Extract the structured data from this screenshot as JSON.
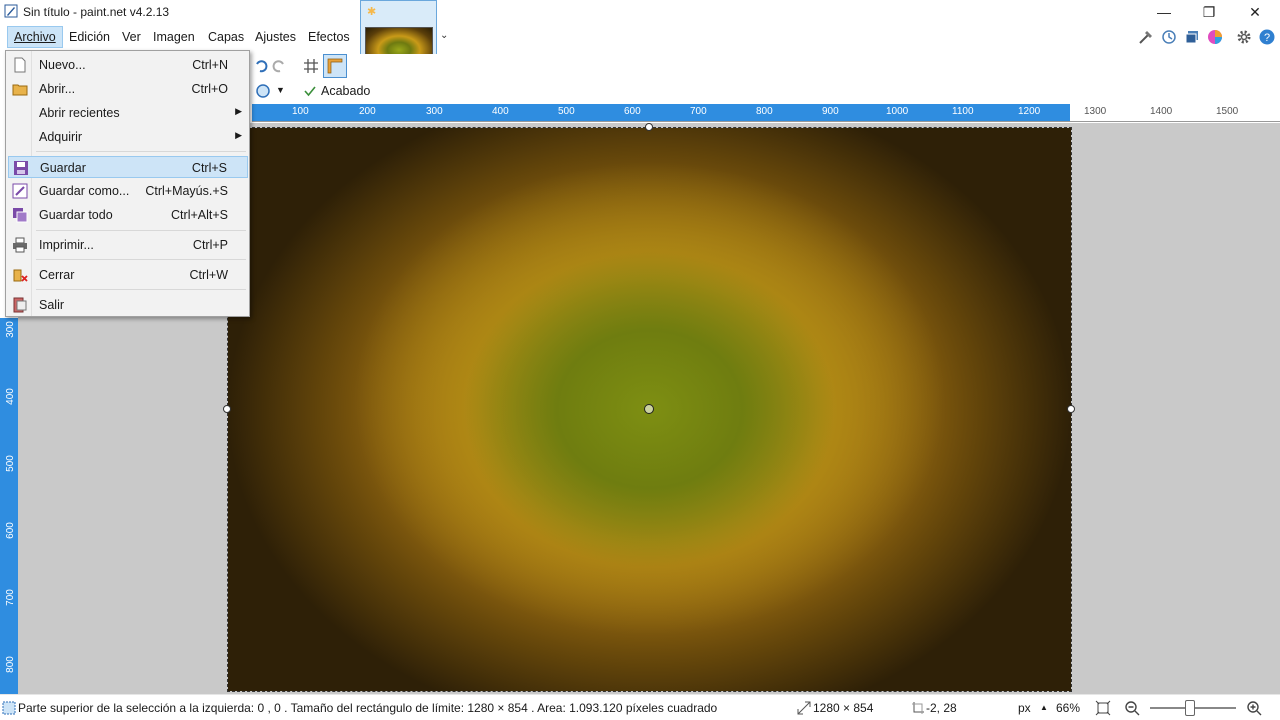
{
  "window": {
    "title": "Sin título - paint.net v4.2.13",
    "minimize": "—",
    "restore": "❐",
    "close": "✕"
  },
  "menu": {
    "items": [
      "Archivo",
      "Edición",
      "Ver",
      "Imagen",
      "Capas",
      "Ajustes",
      "Efectos"
    ],
    "active": "Archivo"
  },
  "toolbar": {
    "acabado_label": "Acabado"
  },
  "ruler_h": [
    "100",
    "200",
    "300",
    "400",
    "500",
    "600",
    "700",
    "800",
    "900",
    "1000",
    "1100",
    "1200",
    "1300",
    "1400",
    "1500"
  ],
  "ruler_v": [
    "300",
    "400",
    "500",
    "600",
    "700",
    "800"
  ],
  "dropdown": {
    "items": [
      {
        "label": "Nuevo...",
        "shortcut": "Ctrl+N",
        "icon": "new-file-icon"
      },
      {
        "label": "Abrir...",
        "shortcut": "Ctrl+O",
        "icon": "open-folder-icon"
      },
      {
        "label": "Abrir recientes",
        "shortcut": "",
        "icon": "",
        "submenu": true
      },
      {
        "label": "Adquirir",
        "shortcut": "",
        "icon": "",
        "submenu": true
      },
      {
        "label": "Guardar",
        "shortcut": "Ctrl+S",
        "icon": "save-icon",
        "highlight": true
      },
      {
        "label": "Guardar como...",
        "shortcut": "Ctrl+Mayús.+S",
        "icon": "save-as-icon"
      },
      {
        "label": "Guardar todo",
        "shortcut": "Ctrl+Alt+S",
        "icon": "save-all-icon"
      },
      {
        "label": "Imprimir...",
        "shortcut": "Ctrl+P",
        "icon": "printer-icon"
      },
      {
        "label": "Cerrar",
        "shortcut": "Ctrl+W",
        "icon": "close-file-icon"
      },
      {
        "label": "Salir",
        "shortcut": "",
        "icon": "exit-icon"
      }
    ]
  },
  "status": {
    "selection_info": "Parte superior de la selección a la izquierda: 0 , 0 . Tamaño del rectángulo de límite: 1280  × 854 . Area: 1.093.120 píxeles cuadrado",
    "image_size": "1280 × 854",
    "cursor_pos": "-2, 28",
    "unit": "px",
    "zoom": "66%"
  },
  "colors": {
    "accent": "#2f8de0",
    "menu_highlight": "#cde4f7",
    "canvas_bg": "#c9c9c9"
  }
}
